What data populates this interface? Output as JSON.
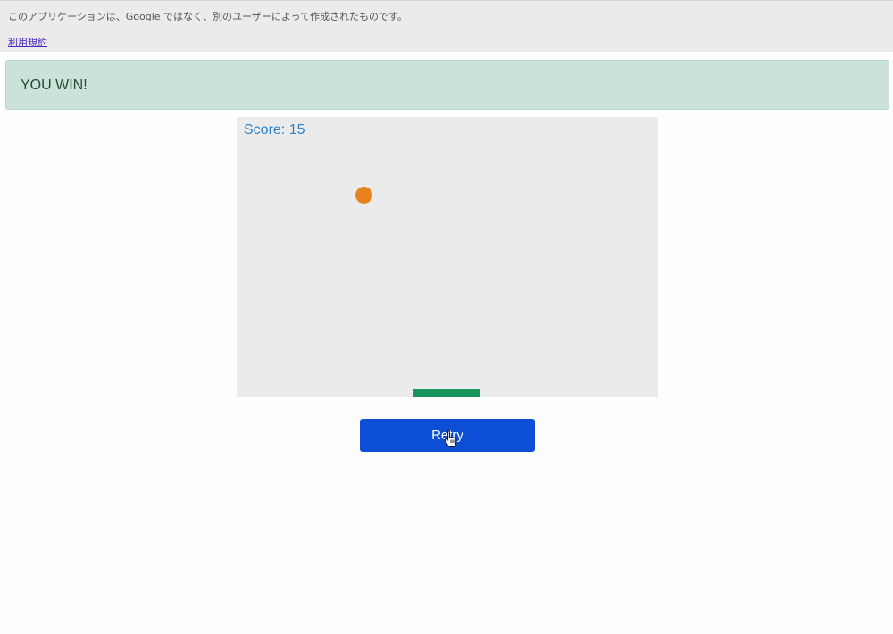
{
  "banner": {
    "notice": "このアプリケーションは、Google ではなく、別のユーザーによって作成されたものです。",
    "terms_link": "利用規約"
  },
  "alert": {
    "message": "YOU WIN!"
  },
  "game": {
    "score_text": "Score: 15"
  },
  "controls": {
    "retry_label": "Retry"
  },
  "colors": {
    "alert_bg": "#cbe2d8",
    "canvas_bg": "#ecebeb",
    "score": "#2b82c9",
    "ball": "#e9821e",
    "paddle": "#17955a",
    "button": "#0c4fd6"
  },
  "icons": {
    "cursor": "hand-pointer-icon"
  }
}
